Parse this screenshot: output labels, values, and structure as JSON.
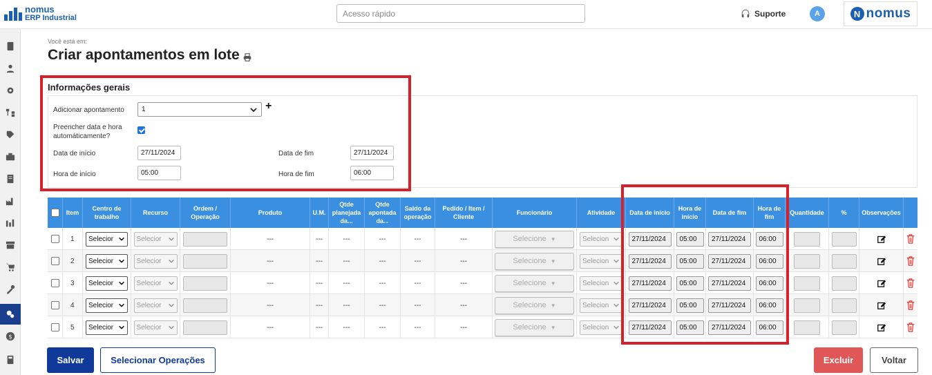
{
  "app": {
    "name_line1": "nomus",
    "name_line2": "ERP Industrial",
    "brand": "nomus",
    "brand_mark": "N"
  },
  "header": {
    "quick_placeholder": "Acesso rápido",
    "support": "Suporte",
    "avatar": "A"
  },
  "sidebar": {
    "icons": [
      "document-icon",
      "user-icon",
      "gear-icon",
      "hierarchy-icon",
      "tag-icon",
      "briefcase-icon",
      "report-icon",
      "factory-icon",
      "production-icon",
      "archive-icon",
      "cart-icon",
      "tools-icon",
      "settings-icon",
      "dollar-icon",
      "calculator-icon"
    ],
    "active": "settings-icon"
  },
  "page": {
    "breadcrumb": "Você está em:",
    "title": "Criar apontamentos em lote"
  },
  "general": {
    "title": "Informações gerais",
    "add_label": "Adicionar apontamento",
    "add_value": "1",
    "autofill_label_1": "Preencher data e hora",
    "autofill_label_2": "automáticamente?",
    "autofill_checked": true,
    "start_date_label": "Data de início",
    "start_date": "27/11/2024",
    "end_date_label": "Data de fim",
    "end_date": "27/11/2024",
    "start_time_label": "Hora de início",
    "start_time": "05:00",
    "end_time_label": "Hora de fim",
    "end_time": "06:00"
  },
  "table": {
    "headers": {
      "item": "Item",
      "centro": "Centro de trabalho",
      "recurso": "Recurso",
      "ordem": "Ordem / Operação",
      "produto": "Produto",
      "um": "U.M.",
      "qtde_plan": "Qtde planejada da...",
      "qtde_apont": "Qtde apontada da...",
      "saldo": "Saldo da operação",
      "pedido": "Pedido / Item / Cliente",
      "funcionario": "Funcionário",
      "atividade": "Atividade",
      "data_inicio": "Data de início",
      "hora_inicio": "Hora de início",
      "data_fim": "Data de fim",
      "hora_fim": "Hora de fim",
      "quantidade": "Quantidade",
      "pct": "%",
      "obs": "Observações"
    },
    "placeholder_select": "Selecione",
    "centro_short": "Selecior",
    "recurso_short": "Selecior",
    "atividade_short": "Selecion",
    "dash": "---",
    "rows": [
      {
        "item": "1",
        "data_inicio": "27/11/2024",
        "hora_inicio": "05:00",
        "data_fim": "27/11/2024",
        "hora_fim": "06:00"
      },
      {
        "item": "2",
        "data_inicio": "27/11/2024",
        "hora_inicio": "05:00",
        "data_fim": "27/11/2024",
        "hora_fim": "06:00"
      },
      {
        "item": "3",
        "data_inicio": "27/11/2024",
        "hora_inicio": "05:00",
        "data_fim": "27/11/2024",
        "hora_fim": "06:00"
      },
      {
        "item": "4",
        "data_inicio": "27/11/2024",
        "hora_inicio": "05:00",
        "data_fim": "27/11/2024",
        "hora_fim": "06:00"
      },
      {
        "item": "5",
        "data_inicio": "27/11/2024",
        "hora_inicio": "05:00",
        "data_fim": "27/11/2024",
        "hora_fim": "06:00"
      }
    ]
  },
  "buttons": {
    "save": "Salvar",
    "select_ops": "Selecionar Operações",
    "delete": "Excluir",
    "back": "Voltar"
  },
  "colors": {
    "primary": "#0f3a9a",
    "header_blue": "#3b8fe0",
    "highlight_red": "#d6202a",
    "danger": "#e05757"
  }
}
